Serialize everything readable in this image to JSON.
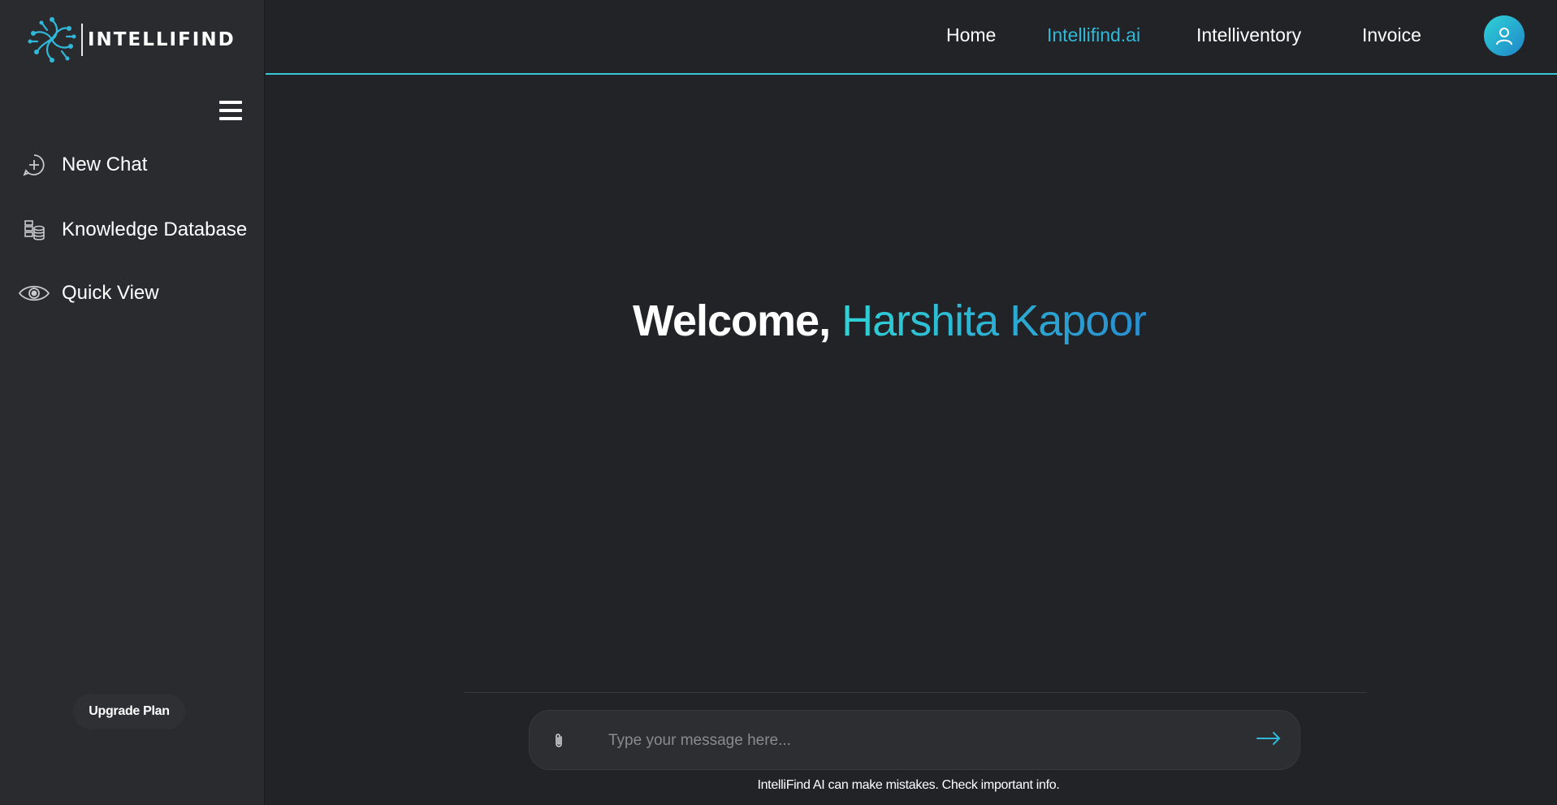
{
  "brand": {
    "name": "INTELLIFIND"
  },
  "sidebar": {
    "items": [
      {
        "label": "New Chat",
        "icon": "plus-circle-icon"
      },
      {
        "label": "Knowledge Database",
        "icon": "database-icon"
      },
      {
        "label": "Quick View",
        "icon": "eye-icon"
      }
    ],
    "upgrade_label": "Upgrade Plan"
  },
  "topnav": {
    "items": [
      {
        "label": "Home"
      },
      {
        "label": "Intellifind.ai",
        "active": true
      },
      {
        "label": "Intelliventory"
      },
      {
        "label": "Invoice"
      }
    ]
  },
  "main": {
    "welcome_prefix": "Welcome,",
    "user_name": "Harshita Kapoor"
  },
  "chat": {
    "placeholder": "Type your message here...",
    "value": "",
    "disclaimer": "IntelliFind AI can make mistakes. Check important info."
  },
  "colors": {
    "accent": "#30b8d9",
    "accent_start": "#2fd3d6",
    "accent_end": "#1f85c9",
    "background": "#222326",
    "sidebar": "#2a2b2f"
  }
}
